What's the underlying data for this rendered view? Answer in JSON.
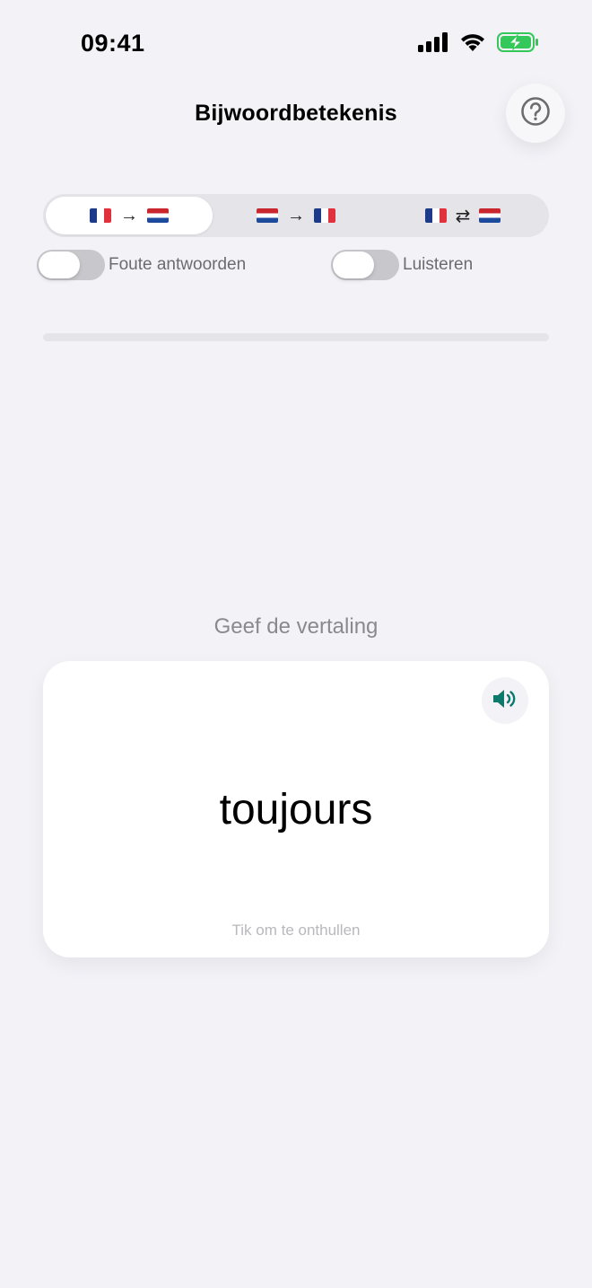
{
  "status_bar": {
    "time": "09:41",
    "icons": [
      "signal-icon",
      "wifi-icon",
      "battery-charging-icon"
    ],
    "battery_color": "#34C759"
  },
  "header": {
    "title": "Bijwoordbetekenis",
    "help_icon": "question-circle-icon"
  },
  "direction_selector": {
    "segments": [
      {
        "from": "fr",
        "to": "nl",
        "symbol": "→",
        "selected": true
      },
      {
        "from": "nl",
        "to": "fr",
        "symbol": "→",
        "selected": false
      },
      {
        "from": "fr",
        "to": "nl",
        "symbol": "⇄",
        "selected": false
      }
    ]
  },
  "toggles": {
    "wrong_answers": {
      "label": "Foute antwoorden",
      "on": false
    },
    "listen": {
      "label": "Luisteren",
      "on": false
    }
  },
  "progress": {
    "value": 0,
    "fill_color": "#0B7A6A"
  },
  "prompt": "Geef de vertaling",
  "card": {
    "word": "toujours",
    "hint": "Tik om te onthullen",
    "speaker_icon": "speaker-icon",
    "accent_color": "#0B7A6A"
  }
}
